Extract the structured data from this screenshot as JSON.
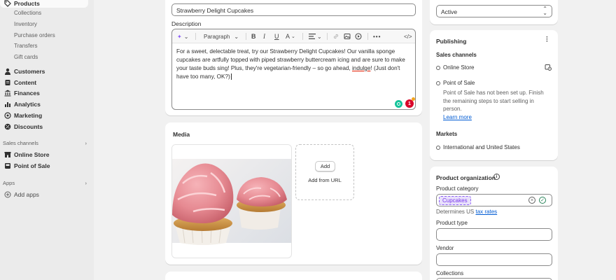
{
  "sidebar": {
    "products": "Products",
    "sub_items": [
      "Collections",
      "Inventory",
      "Purchase orders",
      "Transfers",
      "Gift cards"
    ],
    "main_items": [
      "Customers",
      "Content",
      "Finances",
      "Analytics",
      "Marketing",
      "Discounts"
    ],
    "sales_channels_heading": "Sales channels",
    "sales_channels": [
      "Online Store",
      "Point of Sale"
    ],
    "apps_heading": "Apps",
    "add_apps": "Add apps"
  },
  "product": {
    "title_value": "Strawberry Delight Cupcakes",
    "description_label": "Description",
    "paragraph_select": "Paragraph",
    "description_text_pre": "For a sweet, delectable treat, try our Strawberry Delight Cupcakes! Our vanilla sponge cupcakes are artfully topped with piped strawberry buttercream icing and are sure to make your taste buds sing! Plus, they're vegetarian-friendly – so go ahead, ",
    "description_text_word": "indulge",
    "description_text_post": "! (Just don't have too many, OK?)",
    "ai_badge_count": "1"
  },
  "media": {
    "heading": "Media",
    "add_label": "Add",
    "add_url_label": "Add from URL"
  },
  "status": {
    "value": "Active"
  },
  "publishing": {
    "heading": "Publishing",
    "sales_channels_heading": "Sales channels",
    "online_store": "Online Store",
    "pos": "Point of Sale",
    "pos_note": "Point of Sale has not been set up. Finish the remaining steps to start selling in person.",
    "learn_more": "Learn more",
    "markets_heading": "Markets",
    "markets_value": "International and United States"
  },
  "organization": {
    "heading": "Product organization",
    "category_label": "Product category",
    "category_value": "Cupcakes",
    "determines_text": "Determines US ",
    "tax_rates_link": "tax rates",
    "type_label": "Product type",
    "vendor_label": "Vendor",
    "collections_label": "Collections"
  },
  "colors": {
    "accent": "#005bd3",
    "tag_bg": "#e8e0fb",
    "tag_text": "#7c3aed"
  }
}
